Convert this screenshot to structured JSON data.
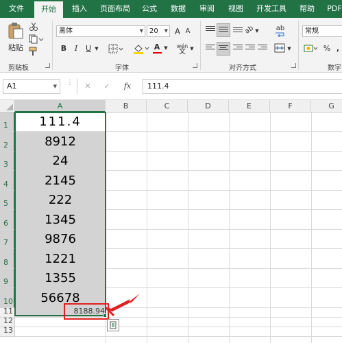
{
  "tabs": [
    "文件",
    "开始",
    "插入",
    "页面布局",
    "公式",
    "数据",
    "审阅",
    "视图",
    "开发工具",
    "帮助",
    "PDF"
  ],
  "ribbon": {
    "clipboard": {
      "paste_label": "粘贴",
      "group_label": "剪贴板"
    },
    "font": {
      "font_name": "黑体",
      "font_size": "20",
      "group_label": "字体",
      "bold": "B",
      "italic": "I",
      "underline": "U",
      "grow": "A",
      "shrink": "A",
      "wen": "wén",
      "font_color": "#e00000",
      "fill_color": "#ffd500"
    },
    "alignment": {
      "group_label": "对齐方式",
      "wrap": "ab",
      "orient": "ab"
    },
    "number": {
      "format": "常规",
      "group_label": "数字",
      "percent": "%",
      "comma": ","
    }
  },
  "formula_bar": {
    "name_box": "A1",
    "cancel": "✕",
    "enter": "✓",
    "fx": "fx",
    "formula": "111.4"
  },
  "columns": [
    "A",
    "B",
    "C",
    "D",
    "E",
    "F",
    "G"
  ],
  "rows": [
    "1",
    "2",
    "3",
    "4",
    "5",
    "6",
    "7",
    "8",
    "9",
    "10",
    "11",
    "12",
    "13"
  ],
  "cells": [
    "111.4",
    "8912",
    "24",
    "2145",
    "222",
    "1345",
    "9876",
    "1221",
    "1355",
    "56678"
  ],
  "sum_label": "8188.94",
  "accent_color": "#217346",
  "highlight_color": "#e02020"
}
